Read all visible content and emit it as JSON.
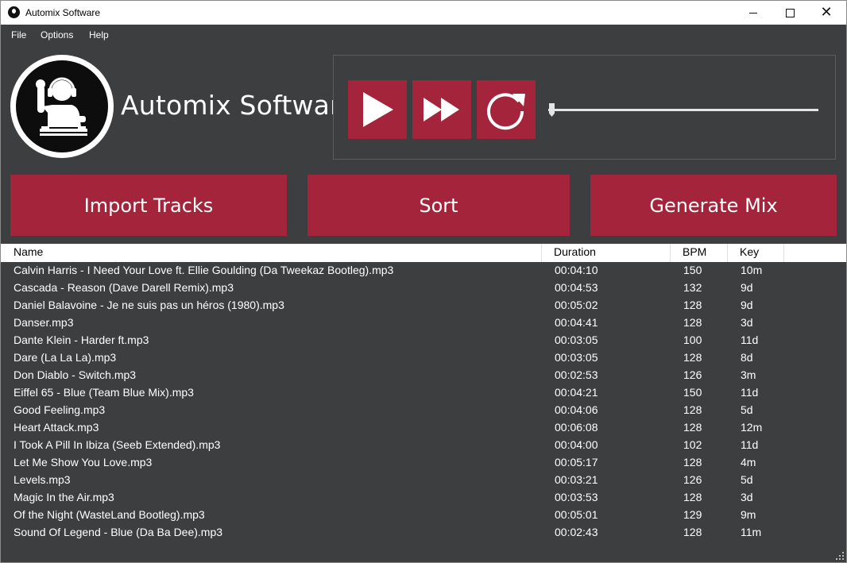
{
  "window": {
    "title": "Automix Software"
  },
  "menu": {
    "file": "File",
    "options": "Options",
    "help": "Help"
  },
  "brand": {
    "name": "Automix Software"
  },
  "player": {
    "volume_fraction": 0
  },
  "actions": {
    "import": "Import Tracks",
    "sort": "Sort",
    "generate": "Generate Mix"
  },
  "colors": {
    "accent": "#a3243b",
    "background": "#3c3e3f",
    "header_bg": "#ffffff"
  },
  "icons": {
    "play": "play-icon",
    "fast_forward": "fast-forward-icon",
    "replay": "replay-icon",
    "logo": "dj-logo-icon"
  },
  "table": {
    "columns": {
      "name": "Name",
      "duration": "Duration",
      "bpm": "BPM",
      "key": "Key"
    },
    "rows": [
      {
        "name": "Calvin Harris - I Need Your Love ft. Ellie Goulding (Da Tweekaz Bootleg).mp3",
        "duration": "00:04:10",
        "bpm": "150",
        "key": "10m"
      },
      {
        "name": "Cascada - Reason (Dave Darell Remix).mp3",
        "duration": "00:04:53",
        "bpm": "132",
        "key": "9d"
      },
      {
        "name": "Daniel Balavoine - Je ne suis pas un héros (1980).mp3",
        "duration": "00:05:02",
        "bpm": "128",
        "key": "9d"
      },
      {
        "name": "Danser.mp3",
        "duration": "00:04:41",
        "bpm": "128",
        "key": "3d"
      },
      {
        "name": "Dante Klein - Harder ft.mp3",
        "duration": "00:03:05",
        "bpm": "100",
        "key": "11d"
      },
      {
        "name": "Dare (La La La).mp3",
        "duration": "00:03:05",
        "bpm": "128",
        "key": "8d"
      },
      {
        "name": "Don Diablo - Switch.mp3",
        "duration": "00:02:53",
        "bpm": "126",
        "key": "3m"
      },
      {
        "name": "Eiffel 65 - Blue (Team Blue Mix).mp3",
        "duration": "00:04:21",
        "bpm": "150",
        "key": "11d"
      },
      {
        "name": "Good Feeling.mp3",
        "duration": "00:04:06",
        "bpm": "128",
        "key": "5d"
      },
      {
        "name": "Heart Attack.mp3",
        "duration": "00:06:08",
        "bpm": "128",
        "key": "12m"
      },
      {
        "name": "I Took A Pill In Ibiza (Seeb Extended).mp3",
        "duration": "00:04:00",
        "bpm": "102",
        "key": "11d"
      },
      {
        "name": "Let Me Show You Love.mp3",
        "duration": "00:05:17",
        "bpm": "128",
        "key": "4m"
      },
      {
        "name": "Levels.mp3",
        "duration": "00:03:21",
        "bpm": "126",
        "key": "5d"
      },
      {
        "name": "Magic In the Air.mp3",
        "duration": "00:03:53",
        "bpm": "128",
        "key": "3d"
      },
      {
        "name": "Of the Night (WasteLand Bootleg).mp3",
        "duration": "00:05:01",
        "bpm": "129",
        "key": "9m"
      },
      {
        "name": "Sound Of Legend - Blue (Da Ba Dee).mp3",
        "duration": "00:02:43",
        "bpm": "128",
        "key": "11m"
      }
    ]
  }
}
